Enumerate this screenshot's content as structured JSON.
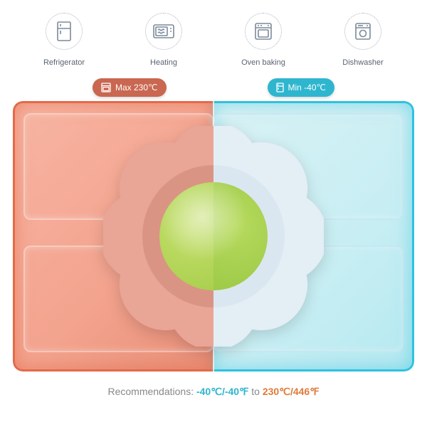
{
  "features": [
    {
      "label": "Refrigerator"
    },
    {
      "label": "Heating"
    },
    {
      "label": "Oven baking"
    },
    {
      "label": "Dishwasher"
    }
  ],
  "badges": {
    "hot": "Max 230℃",
    "cold": "Min -40℃"
  },
  "recommendation": {
    "prefix": "Recommendations: ",
    "cold_range": "-40℃/-40℉",
    "joiner": "  to  ",
    "hot_range": "230℃/446℉"
  },
  "colors": {
    "hot": "#c96750",
    "cold": "#2fb6cf"
  }
}
